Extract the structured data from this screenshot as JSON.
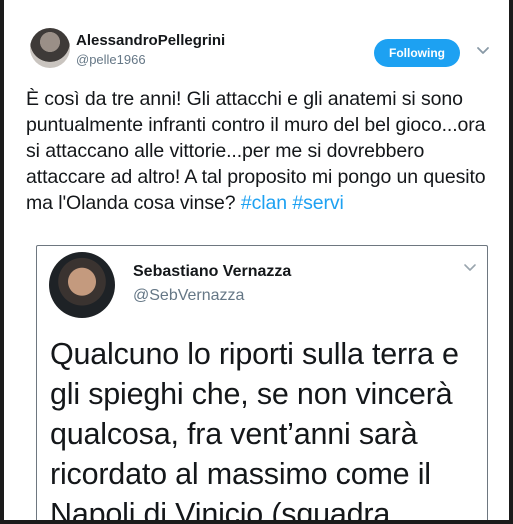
{
  "tweet": {
    "author_name": "AlessandroPellegrini",
    "author_handle": "@pelle1966",
    "follow_label": "Following",
    "text_main": "È così da tre anni! Gli attacchi e gli anatemi si sono puntualmente infranti contro il muro del bel gioco...ora si attaccano alle vittorie...per me si dovrebbero attaccare ad altro! A tal proposito mi pongo un quesito ma l'Olanda cosa vinse?",
    "hashtag_1": "#clan",
    "hashtag_2": "#servi"
  },
  "embedded": {
    "author_name": "Sebastiano Vernazza",
    "author_handle": "@SebVernazza",
    "text": "Qualcuno lo riporti sulla terra e gli spieghi che, se non vincerà qualcosa, fra vent’anni sarà ricordato al massimo come il Napoli di Vinicio (squadra"
  },
  "colors": {
    "accent": "#1da1f2",
    "text": "#14171a",
    "muted": "#657786"
  },
  "icons": {
    "tweet_menu": "chevron-down-icon",
    "embed_menu": "chevron-down-icon"
  }
}
